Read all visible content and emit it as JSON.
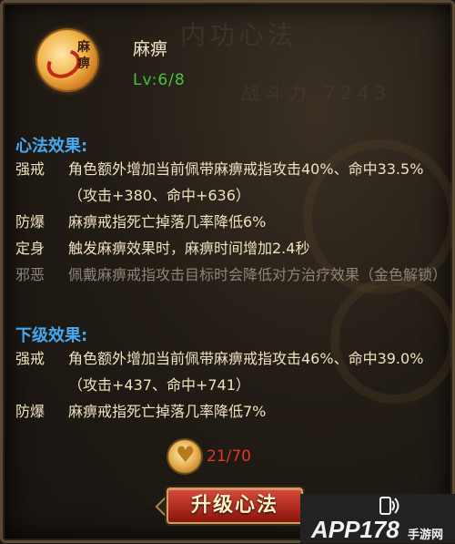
{
  "skill": {
    "icon": "ring-swirl-icon",
    "icon_glyph": "麻痹",
    "name": "麻痹",
    "level": "Lv:6/8"
  },
  "background": {
    "title": "内功心法",
    "power": "战斗力 7243"
  },
  "current_effects": {
    "title": "心法效果:",
    "rows": [
      {
        "tag": "强戒",
        "desc": "角色额外增加当前佩带麻痹戒指攻击40%、命中33.5%（攻击+380、命中+636）",
        "locked": false
      },
      {
        "tag": "防爆",
        "desc": "麻痹戒指死亡掉落几率降低6%",
        "locked": false
      },
      {
        "tag": "定身",
        "desc": "触发麻痹效果时，麻痹时间增加2.4秒",
        "locked": false
      },
      {
        "tag": "邪恶",
        "desc": "佩戴麻痹戒指攻击目标时会降低对方治疗效果（金色解锁）",
        "locked": true
      }
    ]
  },
  "next_effects": {
    "title": "下级效果:",
    "rows": [
      {
        "tag": "强戒",
        "desc": "角色额外增加当前佩带麻痹戒指攻击46%、命中39.0%（攻击+437、命中+741）"
      },
      {
        "tag": "防爆",
        "desc": "麻痹戒指死亡掉落几率降低7%"
      }
    ]
  },
  "upgrade": {
    "cost_icon": "heart-medal-icon",
    "progress_text": "21/70",
    "progress_current": 21,
    "progress_required": 70,
    "button_label": "升级心法"
  },
  "watermark": {
    "text": "APP178",
    "sub": "手游网"
  },
  "colors": {
    "section_title": "#46a8f0",
    "level": "#49c23a",
    "progress": "#e0362a",
    "body_text": "#efe1bf",
    "locked_text": "#8d8676"
  }
}
